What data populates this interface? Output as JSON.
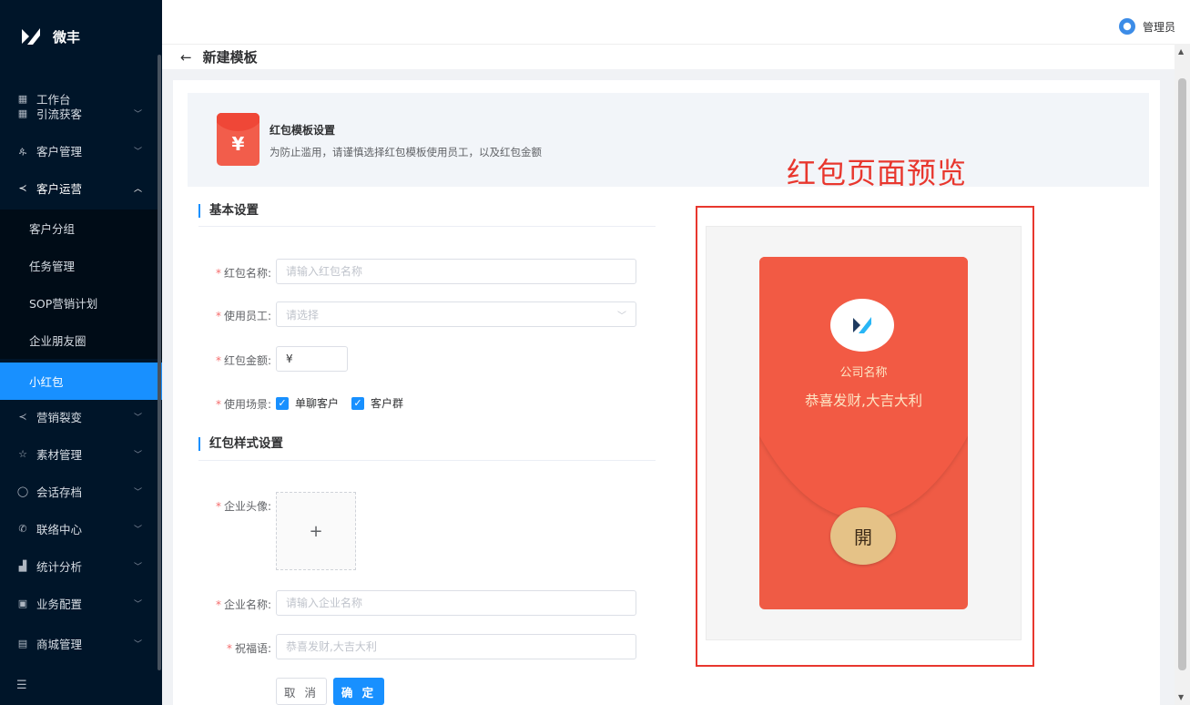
{
  "app": {
    "name": "微丰"
  },
  "sidebar": {
    "items": [
      {
        "label": "工作台",
        "icon": "grid-icon"
      },
      {
        "label": "引流获客",
        "icon": "funnel-icon"
      },
      {
        "label": "客户管理",
        "icon": "users-icon"
      },
      {
        "label": "客户运营",
        "icon": "share-icon"
      },
      {
        "label": "营销裂变",
        "icon": "share-icon"
      },
      {
        "label": "素材管理",
        "icon": "star-icon"
      },
      {
        "label": "会话存档",
        "icon": "chat-icon"
      },
      {
        "label": "联络中心",
        "icon": "phone-icon"
      },
      {
        "label": "统计分析",
        "icon": "chart-icon"
      },
      {
        "label": "业务配置",
        "icon": "config-icon"
      },
      {
        "label": "商城管理",
        "icon": "shop-icon"
      }
    ],
    "sub_items": [
      "客户分组",
      "任务管理",
      "SOP营销计划",
      "企业朋友圈",
      "小红包"
    ],
    "active_sub": "小红包",
    "footer_icon": "collapse-icon"
  },
  "header": {
    "user": "管理员"
  },
  "page": {
    "title": "新建模板",
    "back_icon": "arrow-left-icon"
  },
  "banner": {
    "title": "红包模板设置",
    "desc": "为防止滥用，请谨慎选择红包模板使用员工，以及红包金额",
    "icon_symbol": "¥"
  },
  "preview_label": "红包页面预览",
  "basic": {
    "section_title": "基本设置",
    "name_label": "红包名称:",
    "name_placeholder": "请输入红包名称",
    "staff_label": "使用员工:",
    "staff_placeholder": "请选择",
    "amount_label": "红包金额:",
    "amount_prefix": "¥",
    "scene_label": "使用场景:",
    "scene_options": [
      "单聊客户",
      "客户群"
    ]
  },
  "style": {
    "section_title": "红包样式设置",
    "avatar_label": "企业头像:",
    "upload_symbol": "+",
    "company_label": "企业名称:",
    "company_placeholder": "请输入企业名称",
    "bless_label": "祝福语:",
    "bless_placeholder": "恭喜发财,大吉大利"
  },
  "buttons": {
    "cancel": "取 消",
    "ok": "确 定"
  },
  "preview": {
    "company": "公司名称",
    "bless": "恭喜发财,大吉大利",
    "open": "開"
  },
  "colors": {
    "sidebar": "#001529",
    "active": "#1890ff",
    "red": "#ef5b45",
    "gold": "#e5c287",
    "highlight": "#e8372e"
  }
}
